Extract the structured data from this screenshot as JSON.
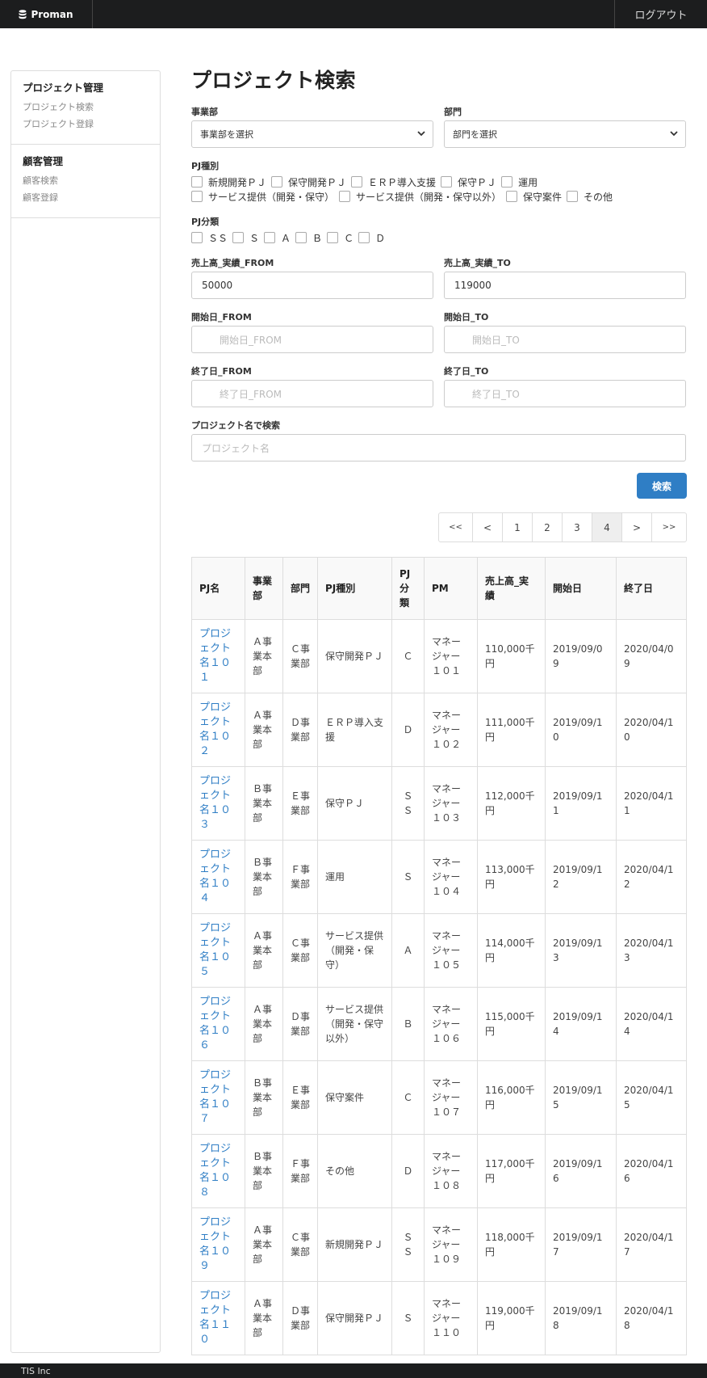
{
  "app": {
    "brand": "Proman",
    "logout": "ログアウト",
    "footer": "TIS Inc"
  },
  "sidebar": {
    "sections": [
      {
        "title": "プロジェクト管理",
        "items": [
          "プロジェクト検索",
          "プロジェクト登録"
        ]
      },
      {
        "title": "顧客管理",
        "items": [
          "顧客検索",
          "顧客登録"
        ]
      }
    ]
  },
  "search": {
    "title": "プロジェクト検索",
    "division_label": "事業部",
    "division_value": "事業部を選択",
    "dept_label": "部門",
    "dept_value": "部門を選択",
    "pj_type_label": "PJ種別",
    "pj_types_line1": [
      "新規開発ＰＪ",
      "保守開発ＰＪ",
      "ＥＲＰ導入支援",
      "保守ＰＪ",
      "運用"
    ],
    "pj_types_line2": [
      "サービス提供（開発・保守）",
      "サービス提供（開発・保守以外）",
      "保守案件",
      "その他"
    ],
    "pj_class_label": "PJ分類",
    "pj_classes": [
      "ＳＳ",
      "Ｓ",
      "Ａ",
      "Ｂ",
      "Ｃ",
      "Ｄ"
    ],
    "sales_from_label": "売上高_実績_FROM",
    "sales_from_value": "50000",
    "sales_to_label": "売上高_実績_TO",
    "sales_to_value": "119000",
    "start_from_label": "開始日_FROM",
    "start_from_placeholder": "開始日_FROM",
    "start_to_label": "開始日_TO",
    "start_to_placeholder": "開始日_TO",
    "end_from_label": "終了日_FROM",
    "end_from_placeholder": "終了日_FROM",
    "end_to_label": "終了日_TO",
    "end_to_placeholder": "終了日_TO",
    "name_label": "プロジェクト名で検索",
    "name_placeholder": "プロジェクト名",
    "search_button": "検索"
  },
  "pagination": {
    "items": [
      "<<",
      "<",
      "1",
      "2",
      "3",
      "4",
      ">",
      ">>"
    ],
    "active": "4"
  },
  "table": {
    "headers": [
      "PJ名",
      "事業部",
      "部門",
      "PJ種別",
      "PJ分類",
      "PM",
      "売上高_実績",
      "開始日",
      "終了日"
    ],
    "rows": [
      [
        "プロジェクト名１０１",
        "Ａ事業本部",
        "Ｃ事業部",
        "保守開発ＰＪ",
        "Ｃ",
        "マネージャー１０１",
        "110,000千円",
        "2019/09/09",
        "2020/04/09"
      ],
      [
        "プロジェクト名１０２",
        "Ａ事業本部",
        "Ｄ事業部",
        "ＥＲＰ導入支援",
        "Ｄ",
        "マネージャー１０２",
        "111,000千円",
        "2019/09/10",
        "2020/04/10"
      ],
      [
        "プロジェクト名１０３",
        "Ｂ事業本部",
        "Ｅ事業部",
        "保守ＰＪ",
        "ＳＳ",
        "マネージャー１０３",
        "112,000千円",
        "2019/09/11",
        "2020/04/11"
      ],
      [
        "プロジェクト名１０４",
        "Ｂ事業本部",
        "Ｆ事業部",
        "運用",
        "Ｓ",
        "マネージャー１０４",
        "113,000千円",
        "2019/09/12",
        "2020/04/12"
      ],
      [
        "プロジェクト名１０５",
        "Ａ事業本部",
        "Ｃ事業部",
        "サービス提供（開発・保守）",
        "Ａ",
        "マネージャー１０５",
        "114,000千円",
        "2019/09/13",
        "2020/04/13"
      ],
      [
        "プロジェクト名１０６",
        "Ａ事業本部",
        "Ｄ事業部",
        "サービス提供（開発・保守以外）",
        "Ｂ",
        "マネージャー１０６",
        "115,000千円",
        "2019/09/14",
        "2020/04/14"
      ],
      [
        "プロジェクト名１０７",
        "Ｂ事業本部",
        "Ｅ事業部",
        "保守案件",
        "Ｃ",
        "マネージャー１０７",
        "116,000千円",
        "2019/09/15",
        "2020/04/15"
      ],
      [
        "プロジェクト名１０８",
        "Ｂ事業本部",
        "Ｆ事業部",
        "その他",
        "Ｄ",
        "マネージャー１０８",
        "117,000千円",
        "2019/09/16",
        "2020/04/16"
      ],
      [
        "プロジェクト名１０９",
        "Ａ事業本部",
        "Ｃ事業部",
        "新規開発ＰＪ",
        "ＳＳ",
        "マネージャー１０９",
        "118,000千円",
        "2019/09/17",
        "2020/04/17"
      ],
      [
        "プロジェクト名１１０",
        "Ａ事業本部",
        "Ｄ事業部",
        "保守開発ＰＪ",
        "Ｓ",
        "マネージャー１１０",
        "119,000千円",
        "2019/09/18",
        "2020/04/18"
      ]
    ]
  }
}
